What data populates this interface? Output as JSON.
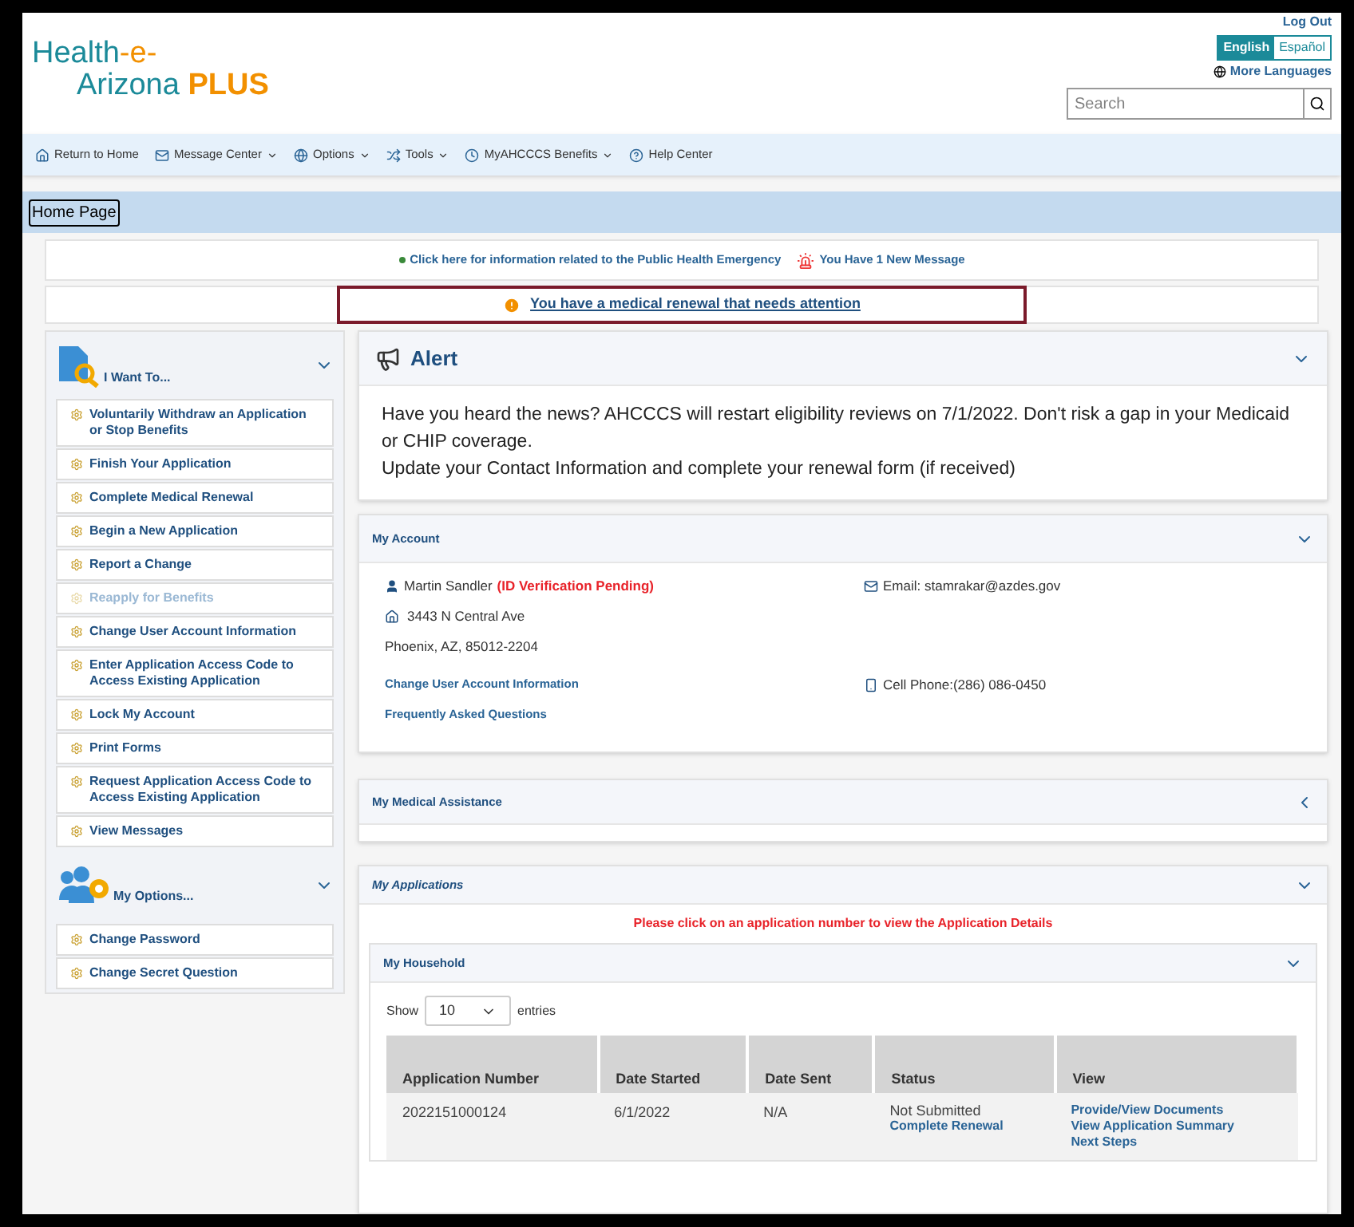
{
  "header": {
    "logo_line1_a": "Health",
    "logo_line1_b": "-e-",
    "logo_line2_a": "Arizona",
    "logo_line2_b": "PLUS",
    "logout": "Log Out",
    "languages": [
      {
        "label": "English",
        "selected": true
      },
      {
        "label": "Español",
        "selected": false
      }
    ],
    "more_languages": "More Languages",
    "search": {
      "placeholder": "Search"
    }
  },
  "nav": [
    {
      "label": "Return to Home",
      "dropdown": false
    },
    {
      "label": "Message Center",
      "dropdown": true
    },
    {
      "label": "Options",
      "dropdown": true
    },
    {
      "label": "Tools",
      "dropdown": true
    },
    {
      "label": "MyAHCCCS Benefits",
      "dropdown": true
    },
    {
      "label": "Help Center",
      "dropdown": false
    }
  ],
  "breadcrumb": "Home Page",
  "notices": {
    "emergency_link": "Click here for information related to the Public Health Emergency",
    "messages": "You Have 1 New Message",
    "renewal": "You have a medical renewal that needs attention"
  },
  "sidebar": {
    "title": "I Want To...",
    "items": [
      {
        "label": "Voluntarily Withdraw an Application or Stop Benefits",
        "disabled": false
      },
      {
        "label": "Finish Your Application",
        "disabled": false
      },
      {
        "label": "Complete Medical Renewal",
        "disabled": false
      },
      {
        "label": "Begin a New Application",
        "disabled": false
      },
      {
        "label": "Report a Change",
        "disabled": false
      },
      {
        "label": "Reapply for Benefits",
        "disabled": true
      },
      {
        "label": "Change User Account Information",
        "disabled": false
      },
      {
        "label": "Enter Application Access Code to Access Existing Application",
        "disabled": false
      },
      {
        "label": "Lock My Account",
        "disabled": false
      },
      {
        "label": "Print Forms",
        "disabled": false
      },
      {
        "label": "Request Application Access Code to Access Existing Application",
        "disabled": false
      },
      {
        "label": "View Messages",
        "disabled": false
      }
    ],
    "options_title": "My Options...",
    "options": [
      {
        "label": "Change Password",
        "disabled": false
      },
      {
        "label": "Change Secret Question",
        "disabled": false
      }
    ]
  },
  "alert": {
    "title": "Alert",
    "lines": [
      "Have you heard the news? AHCCCS will restart eligibility reviews on 7/1/2022. Don't risk a gap in your Medicaid or CHIP coverage.",
      "Update your Contact Information and complete your renewal form (if received)"
    ]
  },
  "account": {
    "title": "My Account",
    "name": "Martin Sandler",
    "status": "(ID Verification Pending)",
    "address1": "3443 N Central Ave",
    "address2": "Phoenix, AZ, 85012-2204",
    "email": "Email: stamrakar@azdes.gov",
    "phone": "Cell Phone:(286) 086-0450",
    "links": [
      "Change User Account Information",
      "Frequently Asked Questions"
    ]
  },
  "medical": {
    "title": "My Medical Assistance",
    "expanded": false
  },
  "applications": {
    "title": "My Applications",
    "hint": "Please click on an application number to view the Application Details",
    "household_title": "My Household",
    "show": "Show",
    "page_size": "10",
    "entries": "entries",
    "columns": [
      "Application Number",
      "Date Started",
      "Date Sent",
      "Status",
      "View"
    ],
    "rows": [
      {
        "number": "2022151000124",
        "started": "6/1/2022",
        "sent": "N/A",
        "status": "Not Submitted",
        "status_link": "Complete Renewal",
        "links": [
          "Provide/View Documents",
          "View Application Summary",
          "Next Steps"
        ]
      }
    ]
  }
}
